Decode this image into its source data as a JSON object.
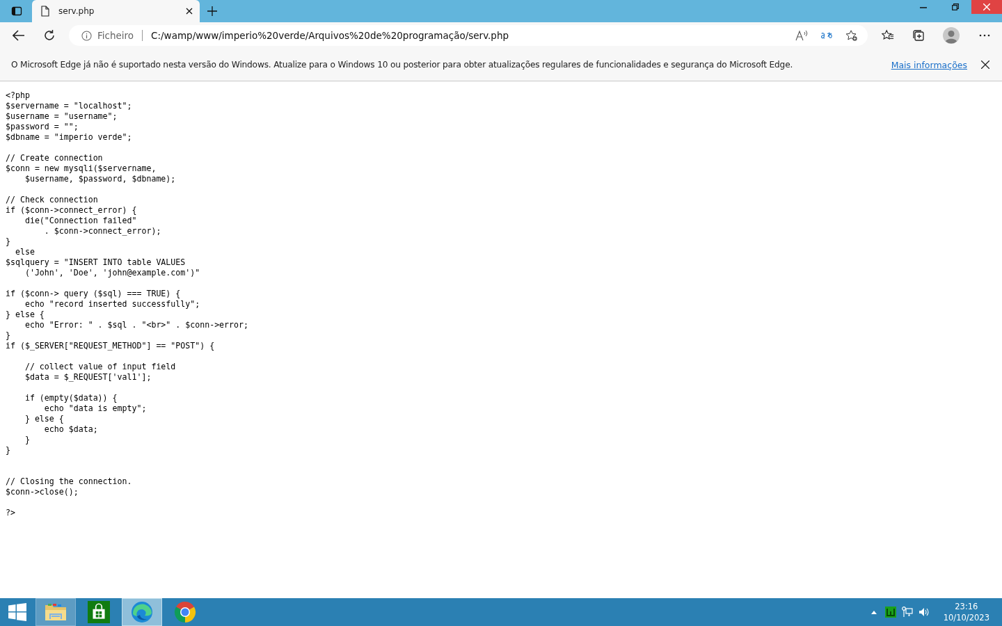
{
  "tab": {
    "title": "serv.php",
    "selected": true
  },
  "address_bar": {
    "scheme_label": "Ficheiro",
    "url": "C:/wamp/www/imperio%20verde/Arquivos%20de%20programação/serv.php"
  },
  "info_bar": {
    "message": "O Microsoft Edge já não é suportado nesta versão do Windows. Atualize para o Windows 10 ou posterior para obter atualizações regulares de funcionalidades e segurança do Microsoft Edge.",
    "link": "Mais informações"
  },
  "page": {
    "code": "<?php\n$servername = \"localhost\";\n$username = \"username\";\n$password = \"\";\n$dbname = \"imperio verde\";\n\n// Create connection\n$conn = new mysqli($servername,\n    $username, $password, $dbname);\n\n// Check connection\nif ($conn->connect_error) {\n    die(\"Connection failed\"\n        . $conn->connect_error);\n}\n  else\n$sqlquery = \"INSERT INTO table VALUES\n    ('John', 'Doe', 'john@example.com')\"\n\nif ($conn-> query ($sql) === TRUE) {\n    echo \"record inserted successfully\";\n} else {\n    echo \"Error: \" . $sql . \"<br>\" . $conn->error;\n}\nif ($_SERVER[\"REQUEST_METHOD\"] == \"POST\") {\n\n    // collect value of input field\n    $data = $_REQUEST['val1'];\n\n    if (empty($data)) {\n        echo \"data is empty\";\n    } else {\n        echo $data;\n    }\n}\n\n\n// Closing the connection.\n$conn->close();\n\n?>"
  },
  "taskbar": {
    "apps": [
      {
        "kind": "explorer",
        "open": true,
        "selected": false
      },
      {
        "kind": "store",
        "open": false,
        "selected": false
      },
      {
        "kind": "edge",
        "open": true,
        "selected": true
      },
      {
        "kind": "chrome",
        "open": false,
        "selected": false
      }
    ],
    "clock": {
      "time": "23:16",
      "date": "10/10/2023"
    }
  }
}
